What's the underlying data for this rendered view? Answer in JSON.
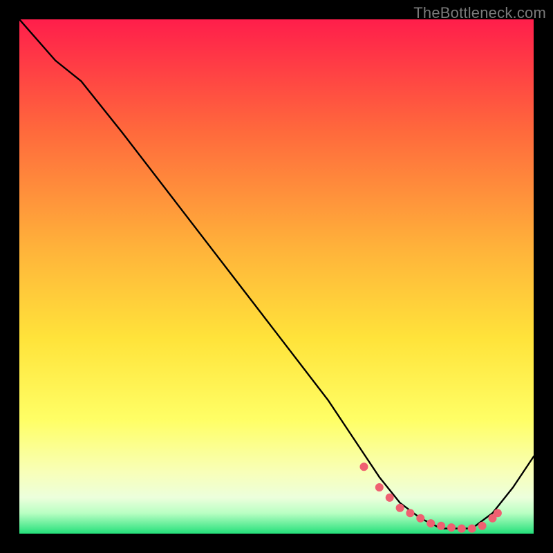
{
  "watermark": "TheBottleneck.com",
  "colors": {
    "gradient_top": "#ff1e4b",
    "gradient_mid1": "#ff7a3a",
    "gradient_mid2": "#ffd23a",
    "gradient_mid3": "#ffff66",
    "gradient_mid4": "#f6ffb0",
    "gradient_bottom_pale": "#eaffd8",
    "gradient_green": "#24e07a",
    "curve": "#000000",
    "marker": "#ef6071"
  },
  "chart_data": {
    "type": "line",
    "title": "",
    "xlabel": "",
    "ylabel": "",
    "xlim": [
      0,
      100
    ],
    "ylim": [
      0,
      100
    ],
    "series": [
      {
        "name": "bottleneck-curve",
        "x": [
          0,
          7,
          12,
          20,
          30,
          40,
          50,
          60,
          66,
          70,
          74,
          78,
          82,
          86,
          88,
          92,
          96,
          100
        ],
        "y": [
          100,
          92,
          88,
          78,
          65,
          52,
          39,
          26,
          17,
          11,
          6,
          3,
          1,
          1,
          1,
          4,
          9,
          15
        ]
      }
    ],
    "markers": {
      "name": "highlight-points",
      "x": [
        67,
        70,
        72,
        74,
        76,
        78,
        80,
        82,
        84,
        86,
        88,
        90,
        92,
        93
      ],
      "y": [
        13,
        9,
        7,
        5,
        4,
        3,
        2,
        1.5,
        1.2,
        1,
        1,
        1.5,
        3,
        4
      ]
    }
  }
}
